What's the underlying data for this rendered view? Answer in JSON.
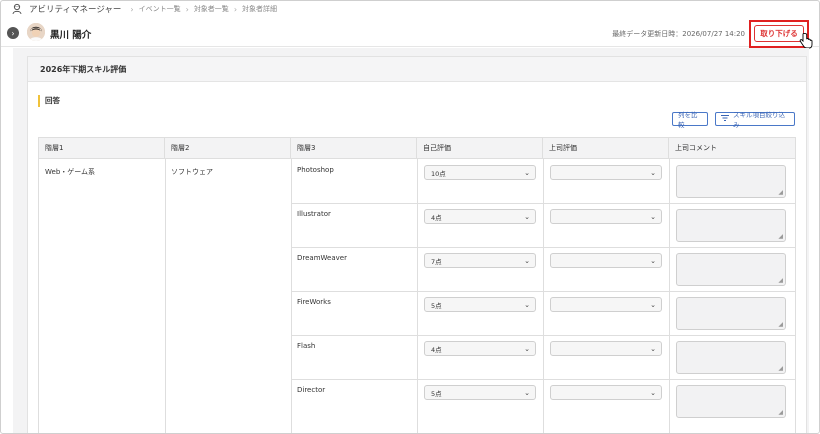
{
  "breadcrumb": {
    "app_name": "アビリティマネージャー",
    "crumbs": [
      "イベント一覧",
      "対象者一覧",
      "対象者詳細"
    ]
  },
  "user": {
    "name": "黒川 陽介",
    "last_update": "最終データ更新日時：2026/07/27 14:20",
    "withdraw_label": "取り下げる"
  },
  "card": {
    "title": "2026年下期スキル評価",
    "section": "回答",
    "compare_button": "列を比較",
    "filter_button": "スキル項目絞り込み"
  },
  "table": {
    "headers": [
      "階層1",
      "階層2",
      "階層3",
      "自己評価",
      "上司評価",
      "上司コメント"
    ],
    "layer1": "Web・ゲーム系",
    "layer2": "ソフトウェア",
    "rows": [
      {
        "skill": "Photoshop",
        "self": "10点",
        "boss": ""
      },
      {
        "skill": "Illustrator",
        "self": "4点",
        "boss": ""
      },
      {
        "skill": "DreamWeaver",
        "self": "7点",
        "boss": ""
      },
      {
        "skill": "FireWorks",
        "self": "5点",
        "boss": ""
      },
      {
        "skill": "Flash",
        "self": "4点",
        "boss": ""
      },
      {
        "skill": "Director",
        "self": "5点",
        "boss": ""
      }
    ]
  },
  "colors": {
    "accent_red": "#e02020",
    "accent_blue": "#4a78c8",
    "section_marker": "#f0c23a"
  }
}
